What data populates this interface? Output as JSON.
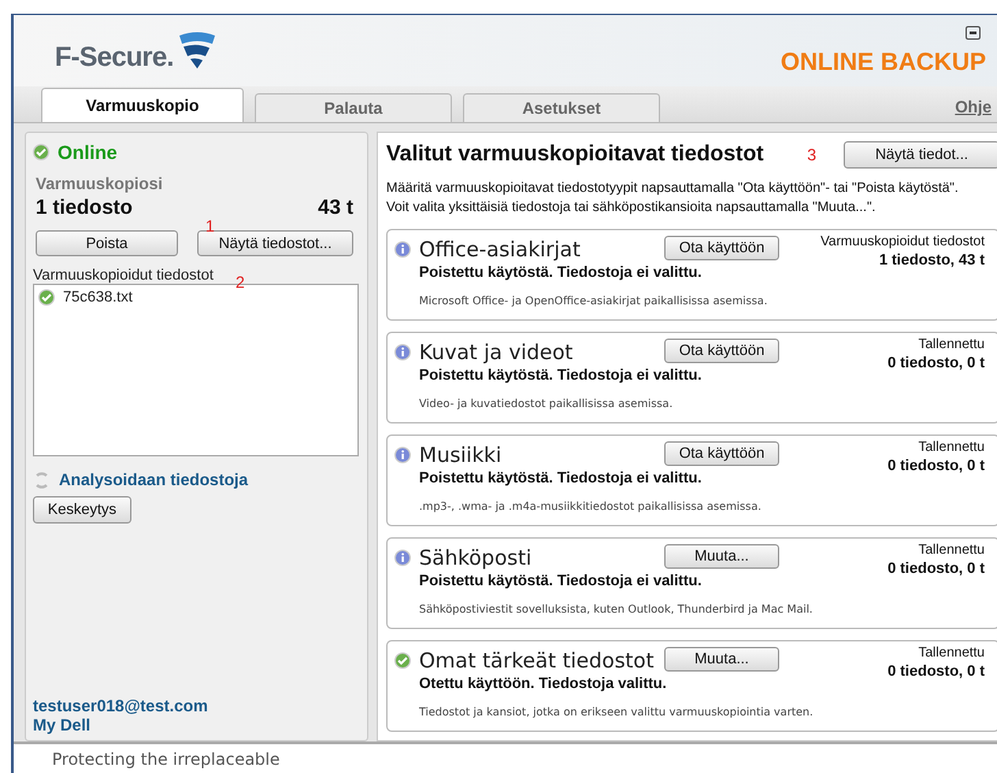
{
  "header": {
    "brand": "F-Secure.",
    "product": "ONLINE BACKUP"
  },
  "tabs": [
    {
      "label": "Varmuuskopio",
      "selected": true
    },
    {
      "label": "Palauta",
      "selected": false
    },
    {
      "label": "Asetukset",
      "selected": false
    }
  ],
  "help_link": "Ohje",
  "left": {
    "status": "Online",
    "online": true,
    "section": "Varmuuskopiosi",
    "file_count": "1 tiedosto",
    "size": "43 t",
    "buttons": [
      "Poista",
      "Näytä tiedostot..."
    ],
    "marker_1": "1",
    "list_label": "Varmuuskopioidut tiedostot",
    "marker_2": "2",
    "files": [
      {
        "name": "75c638.txt"
      }
    ],
    "activity": "Analysoidaan tiedostoja",
    "pause_button": "Keskeytys",
    "account": "testuser018@test.com",
    "link": "My Dell"
  },
  "right": {
    "title": "Valitut varmuuskopioitavat tiedostot",
    "marker_3": "3",
    "details_button": "Näytä tiedot...",
    "intro": [
      "Määritä varmuuskopioitavat tiedostotyypit napsauttamalla \"Ota käyttöön\"- tai \"Poista käytöstä\".",
      "Voit valita yksittäisiä tiedostoja tai sähköpostikansioita napsauttamalla \"Muuta...\"."
    ],
    "categories": [
      {
        "name": "Office-asiakirjat",
        "enabled": false,
        "button": "Ota käyttöön",
        "status": "Poistettu käytöstä. Tiedostoja ei valittu.",
        "description": "Microsoft Office- ja OpenOffice-asiakirjat paikallisissa asemissa.",
        "stat_label": "Varmuuskopioidut tiedostot",
        "stat_value": "1 tiedosto, 43 t"
      },
      {
        "name": "Kuvat ja videot",
        "enabled": false,
        "button": "Ota käyttöön",
        "status": "Poistettu käytöstä. Tiedostoja ei valittu.",
        "description": "Video- ja kuvatiedostot paikallisissa asemissa.",
        "stat_label": "Tallennettu",
        "stat_value": "0 tiedosto, 0 t"
      },
      {
        "name": "Musiikki",
        "enabled": false,
        "button": "Ota käyttöön",
        "status": "Poistettu käytöstä. Tiedostoja ei valittu.",
        "description": ".mp3-, .wma- ja .m4a-musiikkitiedostot paikallisissa asemissa.",
        "stat_label": "Tallennettu",
        "stat_value": "0 tiedosto, 0 t"
      },
      {
        "name": "Sähköposti",
        "enabled": false,
        "button": "Muuta...",
        "status": "Poistettu käytöstä. Tiedostoja ei valittu.",
        "description": "Sähköpostiviestit sovelluksista, kuten Outlook, Thunderbird ja Mac Mail.",
        "stat_label": "Tallennettu",
        "stat_value": "0 tiedosto, 0 t"
      },
      {
        "name": "Omat tärkeät tiedostot",
        "enabled": true,
        "button": "Muuta...",
        "status": "Otettu käyttöön. Tiedostoja valittu.",
        "description": "Tiedostot ja kansiot, jotka on erikseen valittu varmuuskopiointia varten.",
        "stat_label": "Tallennettu",
        "stat_value": "0 tiedosto, 0 t"
      }
    ]
  },
  "footer": "Protecting the irreplaceable"
}
